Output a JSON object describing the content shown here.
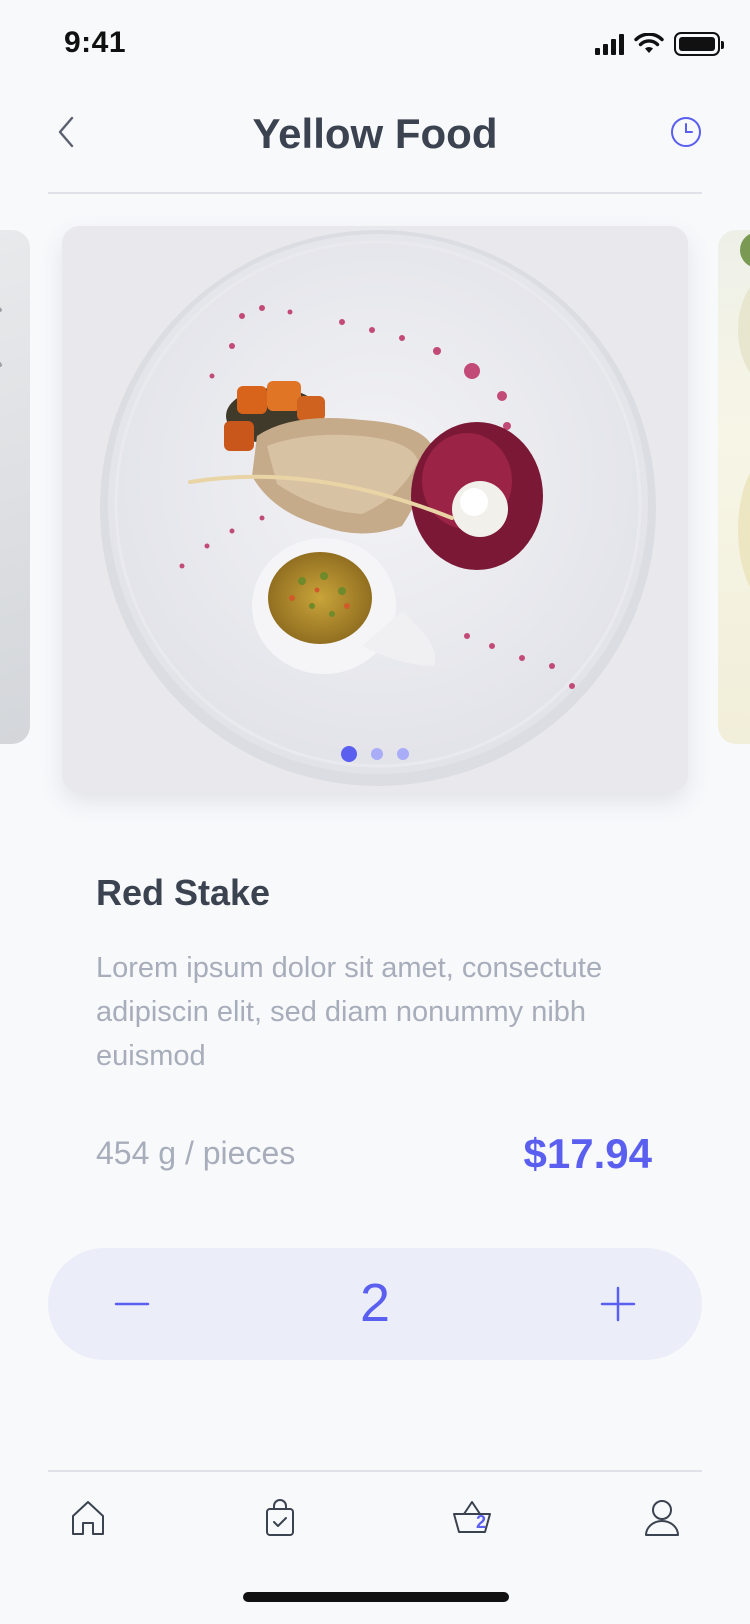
{
  "status_bar": {
    "time": "9:41"
  },
  "header": {
    "title": "Yellow Food"
  },
  "carousel": {
    "active_index": 0,
    "dot_count": 3
  },
  "product": {
    "name": "Red Stake",
    "description": "Lorem ipsum dolor sit amet, consectute adipiscin elit, sed diam nonummy nibh euismod",
    "weight": "454 g / pieces",
    "price": "$17.94"
  },
  "stepper": {
    "value": "2"
  },
  "tab_bar": {
    "cart_badge": "2"
  },
  "colors": {
    "accent": "#5b5ff0",
    "text_primary": "#3c4350",
    "text_muted": "#a8adbb",
    "stepper_bg": "#ebeef8"
  },
  "icons": [
    "back-chevron-icon",
    "clock-icon",
    "minus-icon",
    "plus-icon",
    "home-icon",
    "shopping-bag-icon",
    "basket-icon",
    "user-icon"
  ]
}
